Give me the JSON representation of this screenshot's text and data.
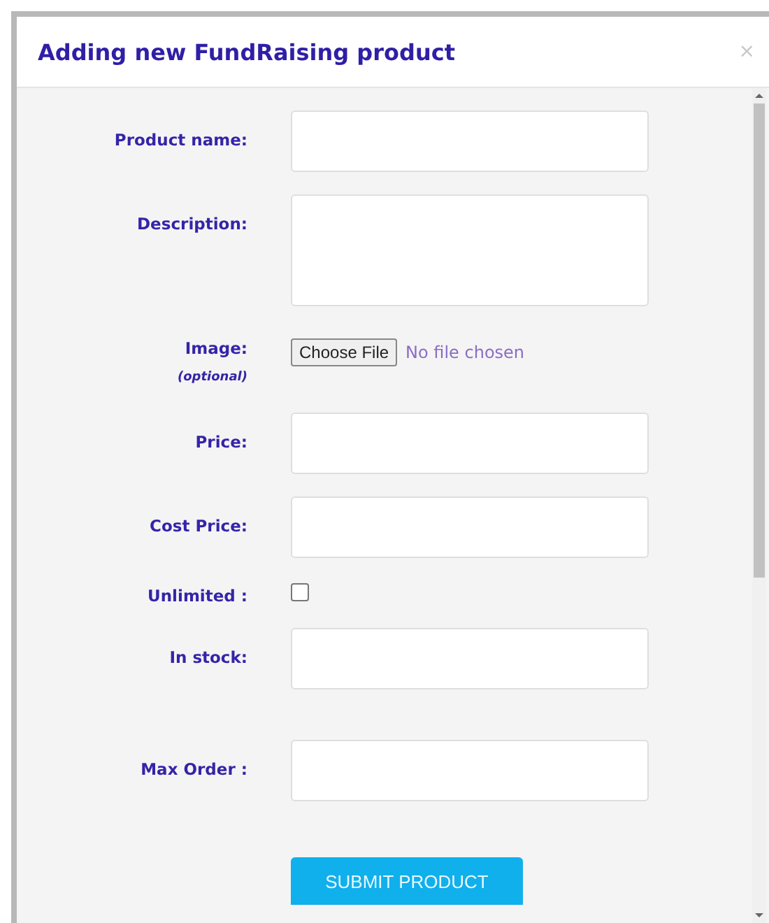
{
  "dialog": {
    "title": "Adding new FundRaising product",
    "close": "×"
  },
  "fields": [
    {
      "kind": "text",
      "label": "Product name:"
    },
    {
      "kind": "textarea",
      "label": "Description:"
    },
    {
      "kind": "file",
      "label": "Image:",
      "note": "(optional)",
      "button": "Choose File",
      "status": "No file chosen"
    },
    {
      "kind": "text",
      "label": "Price:"
    },
    {
      "kind": "text",
      "label": "Cost Price:"
    },
    {
      "kind": "checkbox",
      "label": "Unlimited :",
      "checked": false
    },
    {
      "kind": "text",
      "label": "In stock:"
    },
    {
      "kind": "text",
      "label": "Max Order :"
    }
  ],
  "submit": "SUBMIT PRODUCT"
}
